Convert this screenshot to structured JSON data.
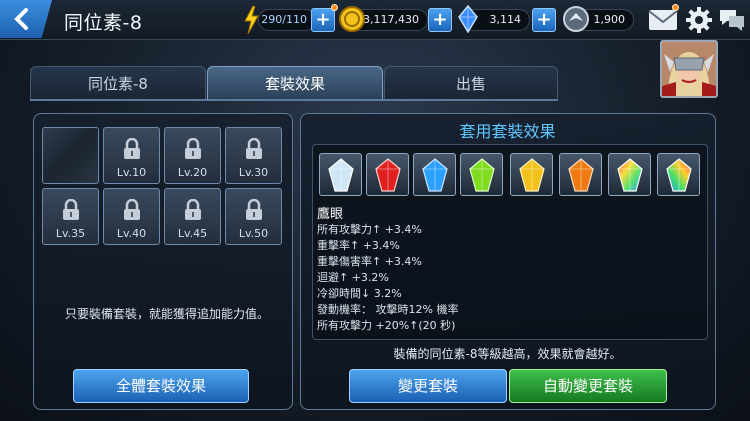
{
  "header": {
    "title": "同位素-8",
    "energy": "290/110",
    "gold": "3,117,430",
    "crystals": "3,114",
    "shards": "1,900"
  },
  "tabs": [
    {
      "label": "同位素-8"
    },
    {
      "label": "套裝效果"
    },
    {
      "label": "出售"
    }
  ],
  "left_panel": {
    "slots": [
      {
        "label": ""
      },
      {
        "label": "Lv.10"
      },
      {
        "label": "Lv.20"
      },
      {
        "label": "Lv.30"
      },
      {
        "label": "Lv.35"
      },
      {
        "label": "Lv.40"
      },
      {
        "label": "Lv.45"
      },
      {
        "label": "Lv.50"
      }
    ],
    "message": "只要裝備套裝，就能獲得追加能力值。",
    "all_sets_button": "全體套裝效果"
  },
  "right_panel": {
    "title": "套用套裝效果",
    "gems": [
      {
        "name": "white-gem-icon",
        "color": "#cfe6f7"
      },
      {
        "name": "red-gem-icon",
        "color": "#e02020"
      },
      {
        "name": "blue-gem-icon",
        "color": "#2aa0ff"
      },
      {
        "name": "green-gem-icon",
        "color": "#7fdc1f"
      },
      {
        "name": "yellow-gem-icon",
        "color": "#f2c21a"
      },
      {
        "name": "orange-gem-icon",
        "color": "#f07a12"
      },
      {
        "name": "rainbow-gem-icon",
        "color": "#b9e84a"
      },
      {
        "name": "rainbow-gem-icon-2",
        "color": "#f6d03a"
      }
    ],
    "effect_name": "鷹眼",
    "effects": [
      "所有攻擊力↑ +3.4%",
      "重擊率↑ +3.4%",
      "重擊傷害率↑ +3.4%",
      "迴避↑ +3.2%",
      "冷卻時間↓ 3.2%",
      "發動機率： 攻擊時12% 機率",
      "所有攻擊力 +20%↑(20 秒)"
    ],
    "note": "裝備的同位素-8等級越高，效果就會越好。",
    "change_button": "變更套裝",
    "auto_button": "自動變更套裝"
  }
}
